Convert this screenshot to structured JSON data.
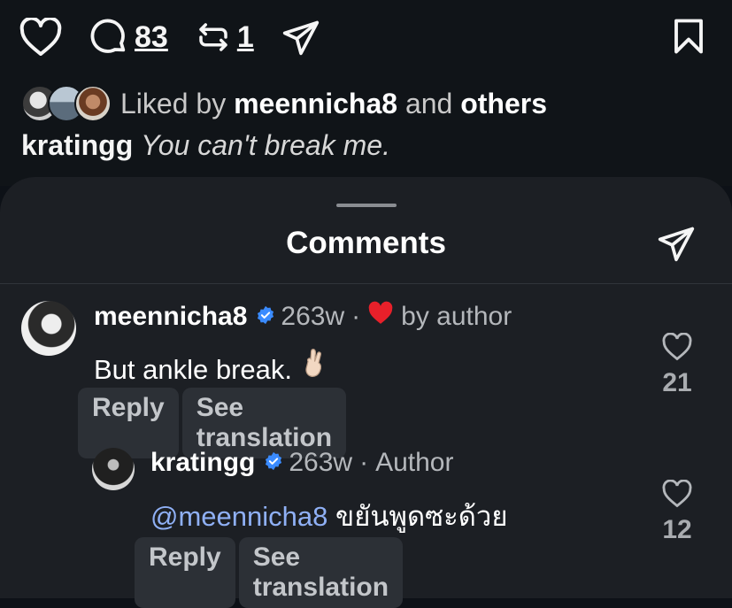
{
  "post": {
    "comments_count": "83",
    "reposts_count": "1",
    "icons": [
      "heart-icon",
      "comment-bubble-icon",
      "repost-icon",
      "send-icon",
      "bookmark-icon"
    ],
    "liked_by": {
      "prefix": "Liked by",
      "user": "meennicha8",
      "and": "and",
      "others": "others"
    },
    "caption": {
      "user": "kratingg",
      "text": "You can't break me."
    }
  },
  "comments_sheet": {
    "title": "Comments",
    "comments": [
      {
        "user": "meennicha8",
        "age": "263w",
        "separator": "·",
        "tag": "by author",
        "text": "But ankle break.",
        "emoji": "crossed-fingers",
        "reply_label": "Reply",
        "translate_label": "See translation",
        "likes": "21"
      },
      {
        "user": "kratingg",
        "age": "263w",
        "separator": "·",
        "tag": "Author",
        "mention": "@meennicha8",
        "text": "ขยันพูดซะด้วย",
        "reply_label": "Reply",
        "translate_label": "See translation",
        "likes": "12"
      }
    ]
  },
  "colors": {
    "background": "#0d1117",
    "sheet": "#1c1f24",
    "verified": "#3a8bff",
    "mention": "#8fb0f5",
    "heart_red": "#e8202a"
  }
}
